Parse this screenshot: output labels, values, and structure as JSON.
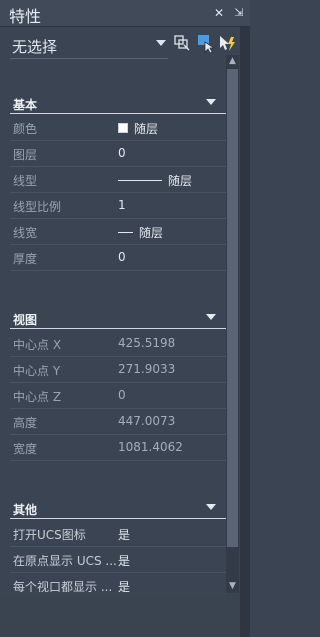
{
  "title": "特性",
  "selection": {
    "label": "无选择"
  },
  "sections": [
    {
      "title": "基本",
      "rows": [
        {
          "label": "颜色",
          "value": "随层",
          "kind": "color"
        },
        {
          "label": "图层",
          "value": "0"
        },
        {
          "label": "线型",
          "value": "随层",
          "kind": "linetype"
        },
        {
          "label": "线型比例",
          "value": "1"
        },
        {
          "label": "线宽",
          "value": "随层",
          "kind": "lineweight"
        },
        {
          "label": "厚度",
          "value": "0"
        }
      ]
    },
    {
      "title": "视图",
      "rows": [
        {
          "label": "中心点 X",
          "value": "425.5198"
        },
        {
          "label": "中心点 Y",
          "value": "271.9033"
        },
        {
          "label": "中心点 Z",
          "value": "0"
        },
        {
          "label": "高度",
          "value": "447.0073"
        },
        {
          "label": "宽度",
          "value": "1081.4062"
        }
      ]
    },
    {
      "title": "其他",
      "rows": [
        {
          "label": "打开UCS图标",
          "value": "是"
        },
        {
          "label": "在原点显示 UCS ...",
          "value": "是"
        },
        {
          "label": "每个视口都显示 ...",
          "value": "是"
        }
      ]
    }
  ],
  "icons": {
    "close": "close-icon",
    "menu": "lightning-icon",
    "quick_select": "quick-select-icon",
    "select_objects": "select-objects-icon",
    "toggle_pickadd": "toggle-pickadd-icon"
  },
  "colors": {
    "background": "#3b4453",
    "accent": "#4a9be0"
  }
}
